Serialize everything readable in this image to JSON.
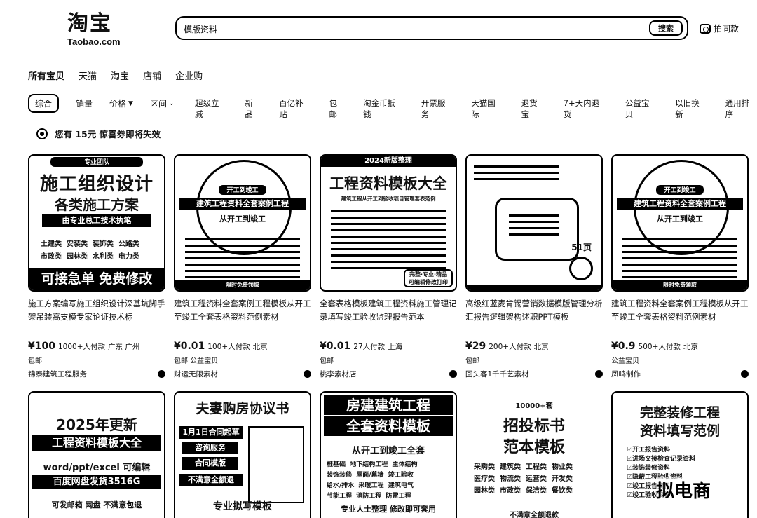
{
  "logo": {
    "cn": "淘宝",
    "en": "Taobao.com"
  },
  "search": {
    "query": "模版资料",
    "button": "搜索",
    "photo_label": "拍同款"
  },
  "tabs": [
    "所有宝贝",
    "天猫",
    "淘宝",
    "店铺",
    "企业购"
  ],
  "sort": {
    "active": "综合",
    "sales": "销量",
    "price": "价格",
    "range": "区间"
  },
  "filters": [
    "超级立减",
    "新品",
    "百亿补贴",
    "包邮",
    "淘金币抵钱",
    "开票服务",
    "天猫国际",
    "退货宝",
    "7+天内退货",
    "公益宝贝",
    "以旧换新",
    "通用排序"
  ],
  "coupon": {
    "text": "您有 15元 惊喜券即将失效"
  },
  "products": [
    {
      "title": "施工方案编写施工组织设计深基坑脚手架吊装高支模专家论证技术标",
      "price": "¥100",
      "sold": "1000+人付款",
      "location": "广东 广州",
      "tag": "包邮",
      "shop": "锦泰建筑工程服务",
      "poster": {
        "top": "专业团队",
        "l1": "施工组织设计",
        "l2": "各类施工方案",
        "l3": "由专业总工技术执笔",
        "tags": "土建类  安装类  装饰类  公路类\n市政类  园林类  水利类  电力类",
        "bottom": "可接急单 免费修改"
      }
    },
    {
      "title": "建筑工程资料全套案例工程模板从开工至竣工全套表格资料范例素材",
      "price": "¥0.01",
      "sold": "100+人付款",
      "location": "北京",
      "tag": "包邮  公益宝贝",
      "shop": "财运无限素材",
      "poster": {
        "top": "开工到竣工",
        "l1": "建筑工程资料全套案例工程",
        "l2": "从开工到竣工",
        "bottom": "限时免费领取"
      }
    },
    {
      "title": "全套表格模板建筑工程资料施工管理记录填写竣工验收监理报告范本",
      "price": "¥0.01",
      "sold": "27人付款",
      "location": "上海",
      "tag": "包邮",
      "shop": "桃李素材店",
      "poster": {
        "top": "2024新版整理",
        "l1": "工程资料模板大全",
        "l2": "建筑工程从开工到验收项目管理套表范例",
        "bottom": "完整·专业·精品\n可编辑修改打印"
      }
    },
    {
      "title": "高级红蓝麦肯锡营销数据模版管理分析汇报告逻辑架构述职PPT模板",
      "price": "¥29",
      "sold": "200+人付款",
      "location": "北京",
      "tag": "包邮",
      "shop": "回头客1千千艺素材",
      "poster": {
        "badge": "51页"
      }
    },
    {
      "title": "建筑工程资料全套案例工程模板从开工至竣工全套表格资料范例素材",
      "price": "¥0.9",
      "sold": "500+人付款",
      "location": "北京",
      "tag": "公益宝贝",
      "shop": "凤鸣制作",
      "poster": {
        "top": "开工到竣工",
        "l1": "建筑工程资料全套案例工程",
        "l2": "从开工到竣工",
        "bottom": "限时免费领取"
      }
    }
  ],
  "row2": [
    {
      "l1": "2025年更新",
      "l2": "工程资料模板大全",
      "l3": "word/ppt/excel 可编辑",
      "l4": "百度网盘发货3516G",
      "l5": "可发邮箱 网盘 不满意包退"
    },
    {
      "l1": "夫妻购房协议书",
      "l2": "1月1日合同起草",
      "l3": "咨询服务",
      "l4": "合同模版",
      "l5": "不满意全额退",
      "l6": "专业拟写模板"
    },
    {
      "l1": "房建建筑工程",
      "l2": "全套资料模板",
      "l3": "从开工到竣工全套",
      "l4": "桩基础  地下结构工程  主体结构\n装饰装修  屋面/幕墙  竣工验收\n给水/排水  采暖工程  建筑电气\n节能工程  消防工程  防雷工程",
      "l5": "专业人士整理 修改即可套用"
    },
    {
      "l0": "10000+套",
      "l1": "招投标书",
      "l2": "范本模板",
      "l3": "采购类  建筑类  工程类  物业类\n医疗类  物流类  运营类  开发类\n园林类  市政类  保洁类  餐饮类",
      "l4": "不满意全额退款"
    },
    {
      "l1": "完整装修工程",
      "l2": "资料填写范例",
      "l3": "☑开工报告资料\n☑进场交接检查记录资料\n☑装饰装修资料\n☑隐蔽工程验收资料\n☑竣工报告资料\n☑竣工验收资料"
    }
  ],
  "watermark": "拟电商"
}
